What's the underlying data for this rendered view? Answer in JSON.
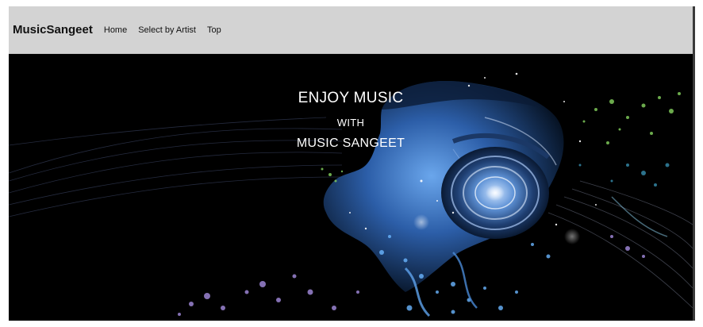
{
  "navbar": {
    "brand": "MusicSangeet",
    "links": [
      "Home",
      "Select by Artist",
      "Top"
    ]
  },
  "hero": {
    "line1": "ENJOY MUSIC",
    "line2": "WITH",
    "line3": "MUSIC SANGEET"
  },
  "colors": {
    "navbar_bg": "#d3d3d3",
    "hero_bg": "#000000",
    "hero_text": "#ffffff",
    "accent_blue": "#3f7fd0"
  }
}
